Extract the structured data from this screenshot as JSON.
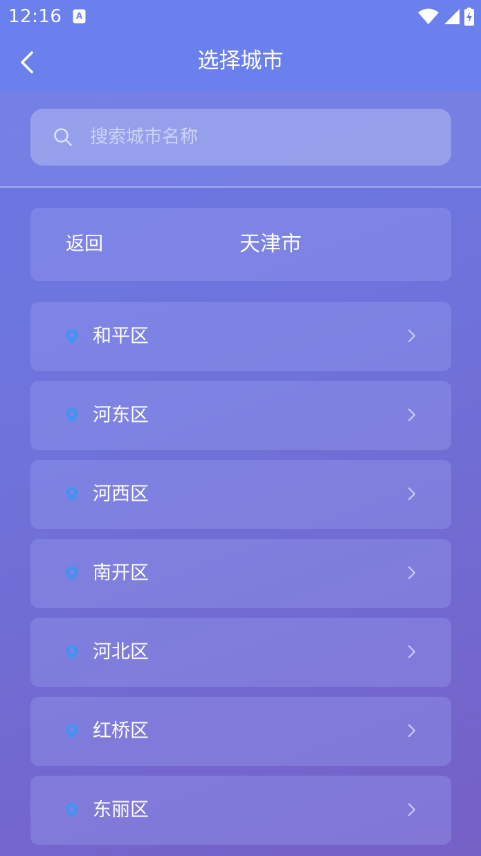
{
  "status_bar": {
    "time": "12:16",
    "icons": [
      "notification-a-icon",
      "wifi-icon",
      "cell-signal-icon",
      "battery-charging-icon"
    ]
  },
  "header": {
    "title": "选择城市",
    "back_icon": "chevron-left-icon"
  },
  "search": {
    "placeholder": "搜索城市名称",
    "value": "",
    "icon": "search-icon"
  },
  "current_city": {
    "return_label": "返回",
    "city_name": "天津市"
  },
  "districts": [
    {
      "label": "和平区"
    },
    {
      "label": "河东区"
    },
    {
      "label": "河西区"
    },
    {
      "label": "南开区"
    },
    {
      "label": "河北区"
    },
    {
      "label": "红桥区"
    },
    {
      "label": "东丽区"
    }
  ],
  "colors": {
    "header_bg": "#6a80ec",
    "pin": "#4a90f0",
    "text": "#ffffff"
  }
}
